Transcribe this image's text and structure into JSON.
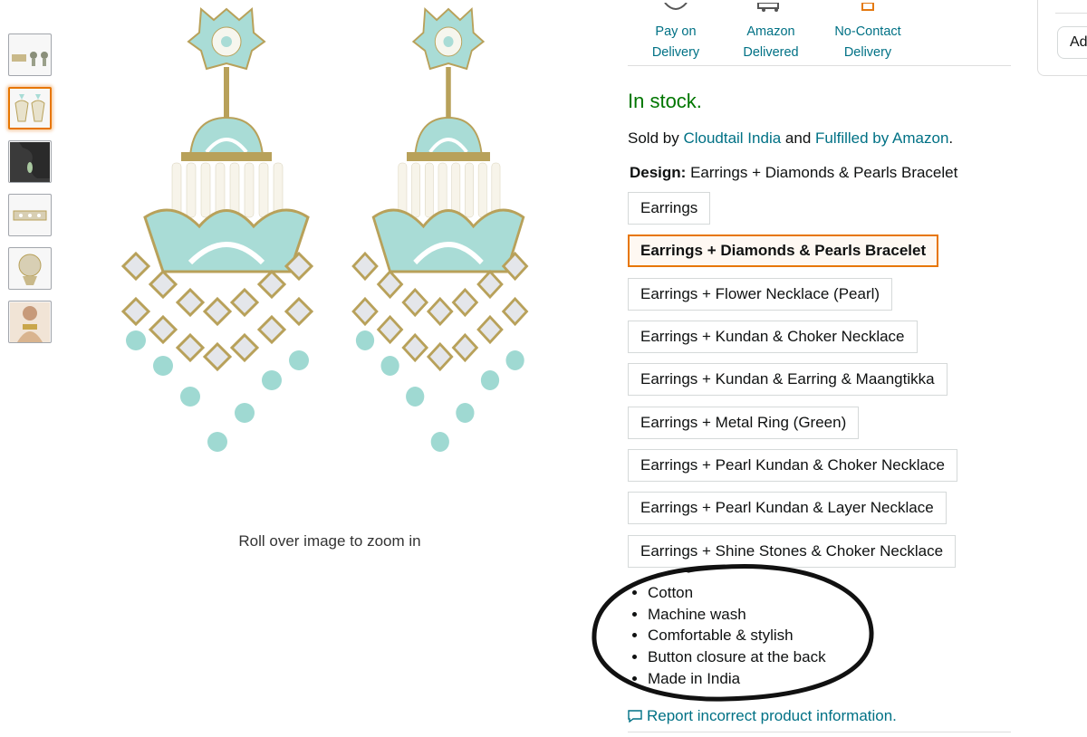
{
  "delivery_icons": [
    {
      "icon": "pay-on-delivery-icon",
      "line1": "Pay on Delivery",
      "line2": ""
    },
    {
      "icon": "truck-icon",
      "line1": "Amazon",
      "line2": "Delivered"
    },
    {
      "icon": "box-icon",
      "line1": "No-Contact",
      "line2": "Delivery"
    }
  ],
  "gallery": {
    "zoom_hint": "Roll over image to zoom in",
    "selected_index": 1
  },
  "availability": "In stock.",
  "sold_by": {
    "prefix": "Sold by ",
    "seller": "Cloudtail India",
    "middle": " and ",
    "fulfilled": "Fulfilled by Amazon",
    "suffix": "."
  },
  "design": {
    "label": "Design:",
    "selected_value": "Earrings + Diamonds & Pearls Bracelet",
    "options": [
      "Earrings",
      "Earrings + Diamonds & Pearls Bracelet",
      "Earrings + Flower Necklace (Pearl)",
      "Earrings + Kundan & Choker Necklace",
      "Earrings + Kundan & Earring & Maangtikka",
      "Earrings + Metal Ring (Green)",
      "Earrings + Pearl Kundan & Choker Necklace",
      "Earrings + Pearl Kundan & Layer Necklace",
      "Earrings + Shine Stones & Choker Necklace"
    ]
  },
  "features": [
    "Cotton",
    "Machine wash",
    "Comfortable & stylish",
    "Button closure at the back",
    "Made in India"
  ],
  "report_link": "Report incorrect product information.",
  "buybox": {
    "add_button": "Ad"
  },
  "colors": {
    "link": "#007185",
    "in_stock": "#007600",
    "selected_border": "#e77600",
    "enamel": "#a9dcd6",
    "gold": "#b8a15a"
  }
}
